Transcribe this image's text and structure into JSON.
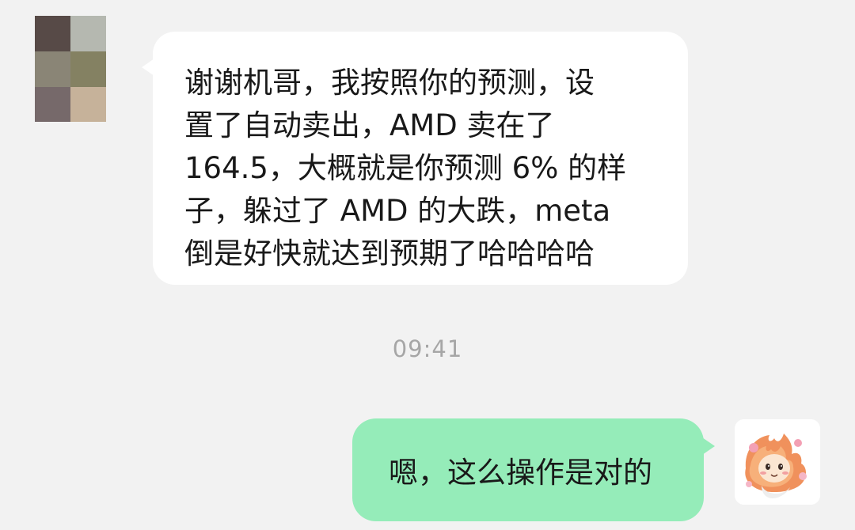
{
  "conversation": {
    "incoming": {
      "sender_avatar": {
        "icon": "pixelated-avatar-icon",
        "mosaic_colors": [
          "#574a47",
          "#b5b8b0",
          "#8a8576",
          "#848162",
          "#76696a",
          "#c6b29a"
        ]
      },
      "message_lines": [
        "谢谢机哥，我按照你的预测，设",
        "置了自动卖出，AMD 卖在了",
        "164.5，大概就是你预测 6% 的样",
        "子，躲过了 AMD 的大跌，meta",
        "倒是好快就达到预期了哈哈哈哈"
      ]
    },
    "timestamp": "09:41",
    "outgoing": {
      "message": "嗯，这么操作是对的",
      "avatar": {
        "icon": "cartoon-cat-avatar-icon"
      }
    }
  },
  "colors": {
    "background": "#f2f2f2",
    "incoming_bubble": "#ffffff",
    "outgoing_bubble": "#95ecb9",
    "message_text": "#191919",
    "timestamp_text": "#a6a6a6"
  }
}
